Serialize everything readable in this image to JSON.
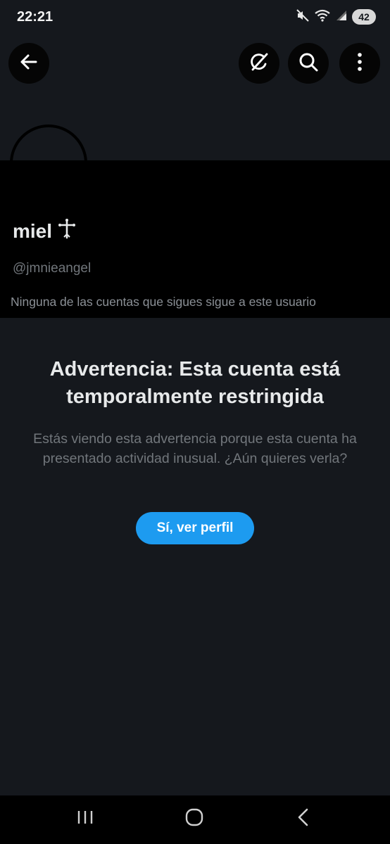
{
  "status_bar": {
    "time": "22:21",
    "battery": "42",
    "icons": [
      "mute-icon",
      "wifi-icon",
      "signal-icon"
    ]
  },
  "header": {
    "back_icon": "arrow-left-icon",
    "grok_icon": "grok-icon",
    "search_icon": "search-icon",
    "more_icon": "more-vertical-icon"
  },
  "profile": {
    "name": "miel",
    "name_symbol": "cross-symbol",
    "handle": "@jmnieangel",
    "followers_note": "Ninguna de las cuentas que sigues sigue a este usuario"
  },
  "warning": {
    "title": "Advertencia: Esta cuenta está temporalmente restringida",
    "body": "Estás viendo esta advertencia porque esta cuenta ha presentado actividad inusual. ¿Aún quieres verla?",
    "button_label": "Sí, ver perfil"
  },
  "colors": {
    "accent": "#1d9bf0",
    "background": "#15181d",
    "text_primary": "#e7e9ea",
    "text_secondary": "#71767b"
  },
  "nav": {
    "icons": [
      "recent-apps-icon",
      "home-icon",
      "back-icon"
    ]
  }
}
